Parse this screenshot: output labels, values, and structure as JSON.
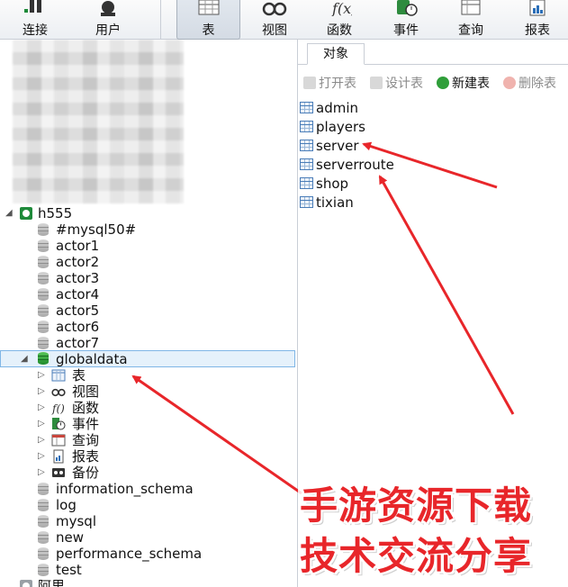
{
  "toolbar": {
    "items": [
      {
        "label": "连接",
        "icon": "connection-icon"
      },
      {
        "label": "用户",
        "icon": "user-icon"
      },
      {
        "label": "表",
        "icon": "table-icon",
        "active": true
      },
      {
        "label": "视图",
        "icon": "view-icon"
      },
      {
        "label": "函数",
        "icon": "function-icon"
      },
      {
        "label": "事件",
        "icon": "event-icon"
      },
      {
        "label": "查询",
        "icon": "query-icon"
      },
      {
        "label": "报表",
        "icon": "report-icon"
      }
    ]
  },
  "tree": {
    "connection": "h555",
    "databases": [
      "#mysql50#",
      "actor1",
      "actor2",
      "actor3",
      "actor4",
      "actor5",
      "actor6",
      "actor7",
      "globaldata"
    ],
    "selected_db": "globaldata",
    "globaldata_children": [
      {
        "label": "表",
        "icon": "table-icon"
      },
      {
        "label": "视图",
        "icon": "view-icon"
      },
      {
        "label": "函数",
        "icon": "function-icon"
      },
      {
        "label": "事件",
        "icon": "event-icon"
      },
      {
        "label": "查询",
        "icon": "query-icon"
      },
      {
        "label": "报表",
        "icon": "report-icon"
      },
      {
        "label": "备份",
        "icon": "backup-icon"
      }
    ],
    "more_databases": [
      "information_schema",
      "log",
      "mysql",
      "new",
      "performance_schema",
      "test"
    ],
    "next_connection": "阿里"
  },
  "right": {
    "tab": "对象",
    "actions": [
      {
        "label": "打开表",
        "disabled": true
      },
      {
        "label": "设计表",
        "disabled": true
      },
      {
        "label": "新建表",
        "disabled": false
      },
      {
        "label": "删除表",
        "disabled": true
      }
    ],
    "tables": [
      "admin",
      "players",
      "server",
      "serverroute",
      "shop",
      "tixian"
    ]
  },
  "watermark": {
    "line1": "手游资源下载",
    "line2": "技术交流分享"
  },
  "colors": {
    "annotation_arrow": "#e8262a",
    "selection": "#e5f1fb"
  }
}
